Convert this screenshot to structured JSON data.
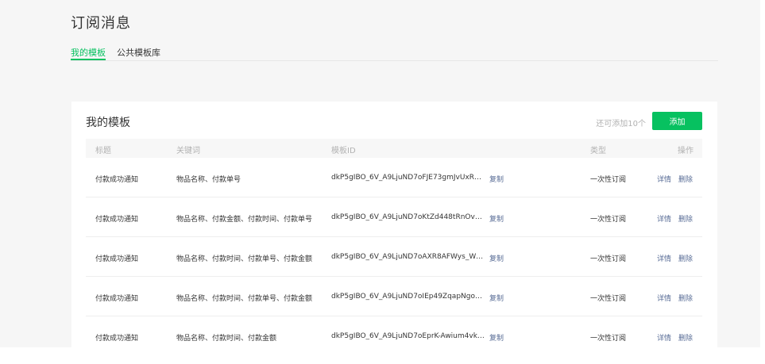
{
  "page": {
    "title": "订阅消息",
    "tabs": [
      {
        "label": "我的模板",
        "active": true
      },
      {
        "label": "公共模板库",
        "active": false
      }
    ]
  },
  "card": {
    "title": "我的模板",
    "remain_text": "还可添加10个",
    "add_label": "添加"
  },
  "table": {
    "headers": {
      "title": "标题",
      "keywords": "关键词",
      "template_id": "模板ID",
      "type": "类型",
      "actions": "操作"
    },
    "rows": [
      {
        "title": "付款成功通知",
        "keywords": "物品名称、付款单号",
        "template_id": "dkP5gIBO_6V_A9LjuND7oFJE73gmJvUxRm…",
        "copy": "复制",
        "type": "一次性订阅",
        "detail": "详情",
        "delete": "删除"
      },
      {
        "title": "付款成功通知",
        "keywords": "物品名称、付款金额、付款时间、付款单号",
        "template_id": "dkP5gIBO_6V_A9LjuND7oKtZd448tRnOvD…",
        "copy": "复制",
        "type": "一次性订阅",
        "detail": "详情",
        "delete": "删除"
      },
      {
        "title": "付款成功通知",
        "keywords": "物品名称、付款时间、付款单号、付款金额",
        "template_id": "dkP5gIBO_6V_A9LjuND7oAXR8AFWys_Wy…",
        "copy": "复制",
        "type": "一次性订阅",
        "detail": "详情",
        "delete": "删除"
      },
      {
        "title": "付款成功通知",
        "keywords": "物品名称、付款时间、付款单号、付款金额",
        "template_id": "dkP5gIBO_6V_A9LjuND7oIEp49ZqapNgoQ…",
        "copy": "复制",
        "type": "一次性订阅",
        "detail": "详情",
        "delete": "删除"
      },
      {
        "title": "付款成功通知",
        "keywords": "物品名称、付款时间、付款金额",
        "template_id": "dkP5gIBO_6V_A9LjuND7oEprK-Awium4vk-…",
        "copy": "复制",
        "type": "一次性订阅",
        "detail": "详情",
        "delete": "删除"
      }
    ]
  },
  "colors": {
    "accent": "#07c160",
    "link": "#576b95",
    "muted": "#b2b2b2",
    "page_bg": "#f6f6f6"
  }
}
